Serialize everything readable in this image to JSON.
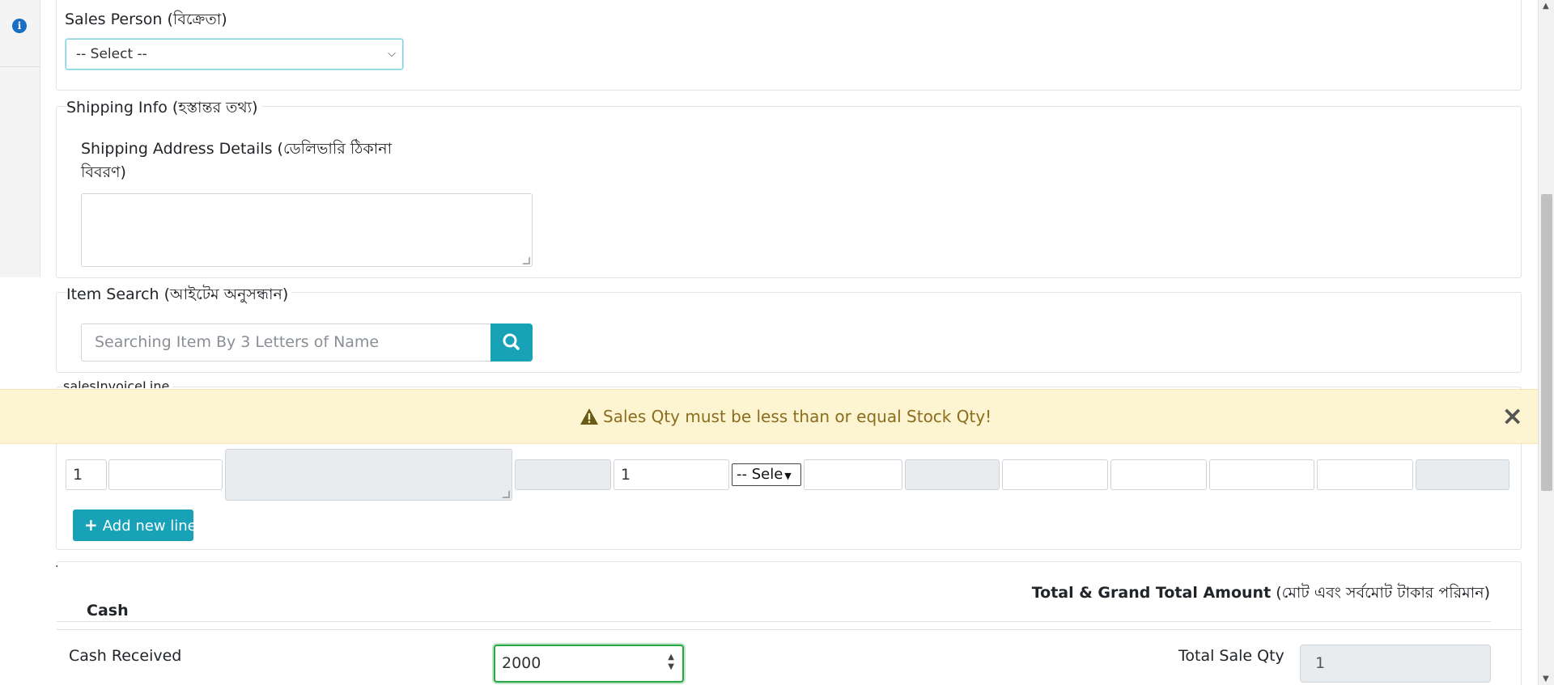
{
  "sales_person": {
    "label": "Sales Person (বিক্রেতা)",
    "select_value": "-- Select --"
  },
  "shipping": {
    "legend": "Shipping Info (হস্তান্তর তথ্য)",
    "address_label_line1": "Shipping Address Details (ডেলিভারি ঠিকানা",
    "address_label_line2": "বিবরণ)",
    "address_value": ""
  },
  "item_search": {
    "legend": "Item Search (আইটেম অনুসন্ধান)",
    "placeholder": "Searching Item By 3 Letters of Name"
  },
  "lines": {
    "hidden_legend": "salesInvoiceLine",
    "row": {
      "index": "1",
      "qty": "1",
      "select_value": "-- Sele"
    },
    "add_label": "Add new line"
  },
  "alert": {
    "message": "Sales Qty must be less than or equal Stock Qty!",
    "close": "×"
  },
  "totals": {
    "dot": ".",
    "title": "Total & Grand Total Amount",
    "title_bn": "(মোট এবং সর্বমোট টাকার পরিমান)",
    "cash_heading": "Cash",
    "cash_received_label": "Cash Received",
    "cash_received_value": "2000",
    "total_sale_qty_label": "Total Sale Qty",
    "total_sale_qty_value": "1"
  },
  "colors": {
    "accent": "#17a2b8",
    "alert_bg": "#fdf4d1",
    "alert_text": "#8a6d1e",
    "focus_green": "#28a745"
  }
}
